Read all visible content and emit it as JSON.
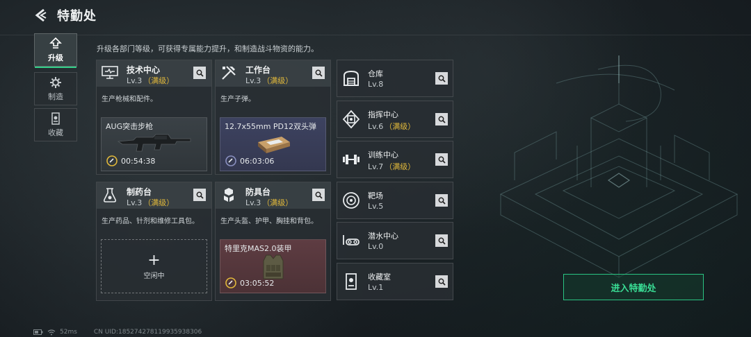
{
  "header": {
    "title": "特勤处"
  },
  "tabs": [
    {
      "label": "升级",
      "icon": "upgrade-icon",
      "active": true
    },
    {
      "label": "制造",
      "icon": "craft-icon",
      "active": false
    },
    {
      "label": "收藏",
      "icon": "collection-icon",
      "active": false
    }
  ],
  "description": "升级各部门等级，可获得专属能力提升，和制造战斗物资的能力。",
  "cards": [
    {
      "name": "技术中心",
      "level": "Lv.3",
      "max": "（满级）",
      "desc": "生产枪械和配件。",
      "product": "AUG突击步枪",
      "timer": "00:54:38",
      "icon": "tech-center-icon"
    },
    {
      "name": "工作台",
      "level": "Lv.3",
      "max": "（满级）",
      "desc": "生产子弹。",
      "product": "12.7x55mm PD12双头弹",
      "timer": "06:03:06",
      "icon": "workbench-icon"
    },
    {
      "name": "制药台",
      "level": "Lv.3",
      "max": "（满级）",
      "desc": "生产药品、针剂和维修工具包。",
      "idle_label": "空闲中",
      "icon": "pharmacy-icon"
    },
    {
      "name": "防具台",
      "level": "Lv.3",
      "max": "（满级）",
      "desc": "生产头盔、护甲、胸挂和背包。",
      "product": "特里克MAS2.0装甲",
      "timer": "03:05:52",
      "icon": "armor-bench-icon"
    }
  ],
  "side_cards": [
    {
      "name": "仓库",
      "level": "Lv.8",
      "max": "",
      "icon": "warehouse-icon"
    },
    {
      "name": "指挥中心",
      "level": "Lv.6",
      "max": "（满级）",
      "icon": "command-center-icon"
    },
    {
      "name": "训练中心",
      "level": "Lv.7",
      "max": "（满级）",
      "icon": "training-center-icon"
    },
    {
      "name": "靶场",
      "level": "Lv.5",
      "max": "",
      "icon": "shooting-range-icon"
    },
    {
      "name": "潜水中心",
      "level": "Lv.0",
      "max": "",
      "icon": "diving-center-icon"
    },
    {
      "name": "收藏室",
      "level": "Lv.1",
      "max": "",
      "icon": "collection-room-icon"
    }
  ],
  "enter_button": "进入特勤处",
  "footer": {
    "ping": "52ms",
    "uid": "CN UID:1852742781199359383​06"
  },
  "colors": {
    "accent": "#33d08a",
    "max_level": "#e2b93b",
    "prod_red": "#5a3a40",
    "prod_blue": "#3a3e5a"
  }
}
